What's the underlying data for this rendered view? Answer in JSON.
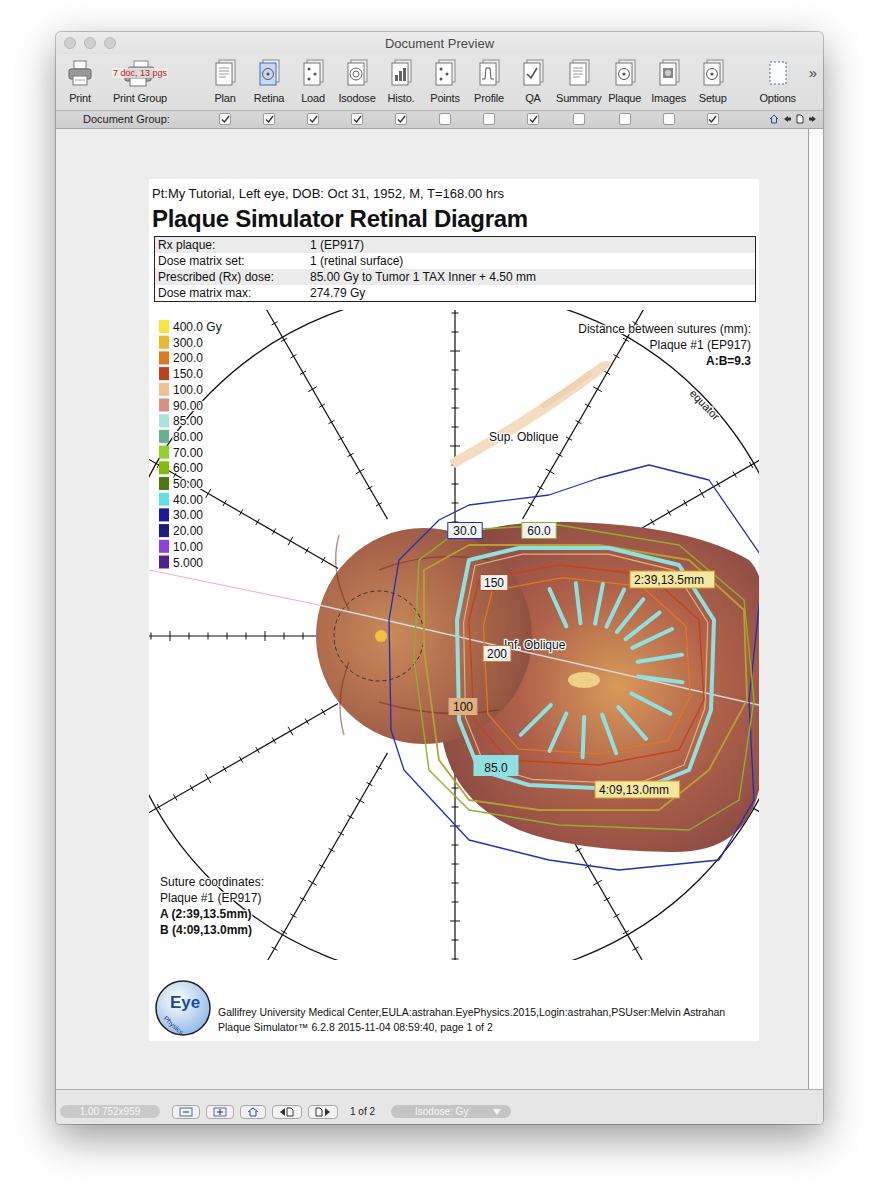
{
  "window": {
    "title": "Document Preview"
  },
  "toolbar": {
    "print": {
      "label": "Print"
    },
    "print_group": {
      "label": "Print Group",
      "badge": "7 doc, 13 pgs"
    },
    "group": [
      {
        "label": "Plan",
        "selected": false,
        "in_group": true
      },
      {
        "label": "Retina",
        "selected": true,
        "in_group": true
      },
      {
        "label": "Load",
        "selected": false,
        "in_group": true
      },
      {
        "label": "Isodose",
        "selected": false,
        "in_group": true
      },
      {
        "label": "Histo.",
        "selected": false,
        "in_group": true
      },
      {
        "label": "Points",
        "selected": false,
        "in_group": false
      },
      {
        "label": "Profile",
        "selected": false,
        "in_group": false
      },
      {
        "label": "QA",
        "selected": false,
        "in_group": true
      },
      {
        "label": "Summary",
        "selected": false,
        "in_group": false
      },
      {
        "label": "Plaque",
        "selected": false,
        "in_group": false
      },
      {
        "label": "Images",
        "selected": false,
        "in_group": false
      },
      {
        "label": "Setup",
        "selected": false,
        "in_group": true
      }
    ],
    "options": {
      "label": "Options"
    },
    "overflow": "»"
  },
  "document_group": {
    "label": "Document Group:"
  },
  "page": {
    "header": "Pt:My Tutorial, Left eye, DOB: Oct 31, 1952, M, T=168.00 hrs",
    "title": "Plaque Simulator Retinal Diagram",
    "info_rows": [
      {
        "label": "Rx plaque:",
        "value": "1 (EP917)"
      },
      {
        "label": "Dose matrix set:",
        "value": "1 (retinal surface)"
      },
      {
        "label": "Prescribed (Rx) dose:",
        "value": "85.00  Gy to Tumor 1 TAX Inner + 4.50 mm"
      },
      {
        "label": "Dose matrix max:",
        "value": "274.79  Gy"
      }
    ],
    "legend": [
      {
        "label": "400.0 Gy",
        "color": "#f5e83a"
      },
      {
        "label": "300.0",
        "color": "#e8b830"
      },
      {
        "label": "200.0",
        "color": "#e07820"
      },
      {
        "label": "150.0",
        "color": "#c0401c"
      },
      {
        "label": "100.0",
        "color": "#f0c090"
      },
      {
        "label": "90.00",
        "color": "#d89080"
      },
      {
        "label": "85.00",
        "color": "#a8e4dc"
      },
      {
        "label": "80.00",
        "color": "#6ab090"
      },
      {
        "label": "70.00",
        "color": "#90d030"
      },
      {
        "label": "60.00",
        "color": "#80c000"
      },
      {
        "label": "50.00",
        "color": "#4a7a10"
      },
      {
        "label": "40.00",
        "color": "#60e0e0"
      },
      {
        "label": "30.00",
        "color": "#1a1aa0"
      },
      {
        "label": "20.00",
        "color": "#1a1a80"
      },
      {
        "label": "10.00",
        "color": "#9040e0"
      },
      {
        "label": "5.000",
        "color": "#502090"
      }
    ],
    "suture_distance": {
      "title": "Distance between sutures (mm):",
      "plaque": "Plaque #1 (EP917)",
      "value": "A:B=9.3"
    },
    "suture_coordinates": {
      "title": "Suture coordinates:",
      "plaque": "Plaque #1 (EP917)",
      "points": [
        "A (2:39,13.5mm)",
        "B (4:09,13.0mm)"
      ]
    },
    "anatomy_labels": {
      "superior_muscle": "Sup. Oblique",
      "inferior_muscle": "Inf. Oblique",
      "equator": "equator"
    },
    "isodose_lines": [
      {
        "label": "30.0",
        "color": "#1a2fbf"
      },
      {
        "label": "60.0",
        "color": "#8fb02a"
      },
      {
        "color": "#b8a030"
      },
      {
        "label": "85.0",
        "color": "#8fe0e0"
      },
      {
        "label": "100",
        "color": "#e0b080"
      },
      {
        "label": "150",
        "color": "#c8401c"
      },
      {
        "label": "200",
        "color": "#e07820"
      }
    ],
    "suture_tags": [
      "2:39,13.5mm",
      "4:09,13.0mm"
    ],
    "logo": {
      "top": "Eye",
      "bottom": "Physics"
    },
    "footer": [
      "Gallifrey University Medical Center,EULA:astrahan.EyePhysics.2015,Login:astrahan,PSUser:Melvin Astrahan",
      "Plaque Simulator™ 6.2.8 2015-11-04 08:59:40, page 1 of 2"
    ]
  },
  "status_bar": {
    "zoom": "1.00 752x959",
    "page": "1 of 2",
    "dropdown": {
      "value": "Isodose: Gy"
    }
  }
}
